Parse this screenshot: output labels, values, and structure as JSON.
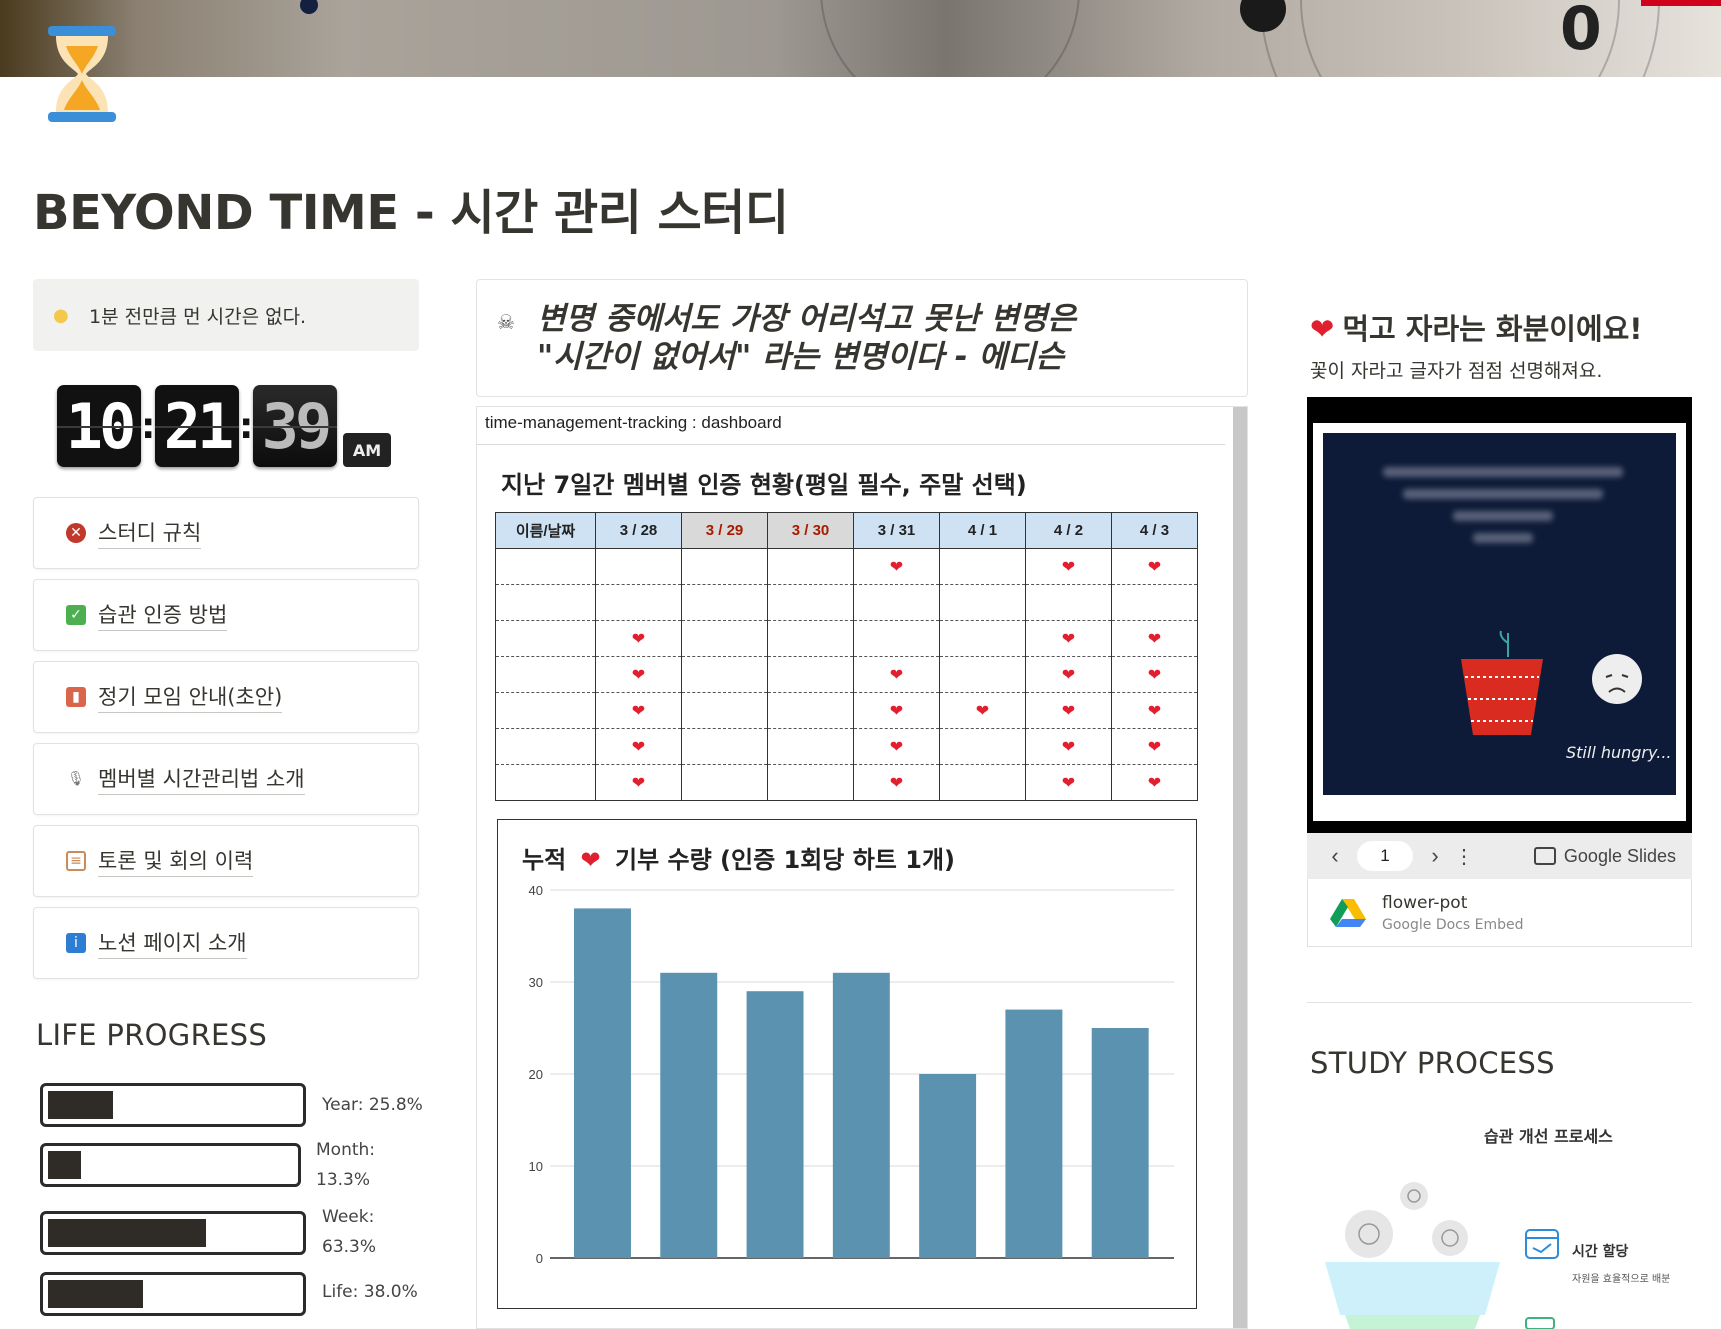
{
  "page": {
    "title": "BEYOND TIME - 시간 관리 스터디"
  },
  "callout": {
    "icon": "lightbulb-icon",
    "text": "1분 전만큼 먼 시간은 없다."
  },
  "clock": {
    "hours": "10",
    "minutes": "21",
    "seconds": "39",
    "ampm": "AM"
  },
  "nav": [
    {
      "label": "스터디 규칙",
      "icon": "no-pedestrians-icon",
      "color": "#c0392b"
    },
    {
      "label": "습관 인증 방법",
      "icon": "check-mark-icon",
      "color": "#4caf50"
    },
    {
      "label": "정기 모임 안내(초안)",
      "icon": "book-icon",
      "color": "#d9664b"
    },
    {
      "label": "멤버별 시간관리법 소개",
      "icon": "microphone-icon",
      "color": "#777777"
    },
    {
      "label": "토론 및 회의 이력",
      "icon": "clipboard-icon",
      "color": "#c98b5a"
    },
    {
      "label": "노션 페이지 소개",
      "icon": "info-icon",
      "color": "#2d7dd2"
    }
  ],
  "life_progress": {
    "heading": "LIFE PROGRESS",
    "items": [
      {
        "label": "Year: 25.8%",
        "fraction": 0.258
      },
      {
        "label_line1": "Month:",
        "label_line2": "13.3%",
        "fraction": 0.133
      },
      {
        "label_line1": "Week:",
        "label_line2": "63.3%",
        "fraction": 0.633
      },
      {
        "label": "Life: 38.0%",
        "fraction": 0.38
      }
    ]
  },
  "quote": {
    "icon": "skull-icon",
    "line1": "변명 중에서도 가장 어리석고 못난 변명은",
    "line2": "\"시간이 없어서\" 라는 변명이다 - 에디슨"
  },
  "embed": {
    "header": "time-management-tracking : dashboard",
    "table_title": "지난 7일간 멤버별 인증 현황(평일 필수, 주말 선택)",
    "columns": [
      "이름/날짜",
      "3 / 28",
      "3 / 29",
      "3 / 30",
      "3 / 31",
      "4 / 1",
      "4 / 2",
      "4 / 3"
    ],
    "weekend_cols": [
      2,
      3
    ],
    "rows": [
      [
        0,
        0,
        0,
        1,
        0,
        1,
        1
      ],
      [
        0,
        0,
        0,
        0,
        0,
        0,
        0
      ],
      [
        1,
        0,
        0,
        0,
        0,
        1,
        1
      ],
      [
        1,
        0,
        0,
        1,
        0,
        1,
        1
      ],
      [
        1,
        0,
        0,
        1,
        1,
        1,
        1
      ],
      [
        1,
        0,
        0,
        1,
        0,
        1,
        1
      ],
      [
        1,
        0,
        0,
        1,
        0,
        1,
        1
      ]
    ],
    "heart": "❤"
  },
  "chart_data": {
    "type": "bar",
    "title_prefix": "누적",
    "title_suffix": "기부 수량 (인증 1회당 하트 1개)",
    "categories": [
      "",
      "",
      "",
      "",
      "",
      "",
      ""
    ],
    "values": [
      38,
      31,
      29,
      31,
      20,
      27,
      25
    ],
    "ylim": [
      0,
      40
    ],
    "yticks": [
      0,
      10,
      20,
      30,
      40
    ],
    "bar_color": "#5a92b0",
    "grid": true
  },
  "right": {
    "heading": "먹고 자라는 화분이에요!",
    "heading_icon": "heart-icon",
    "sub": "꽃이 자라고  글자가 점점 선명해져요.",
    "slide_caption": "Still hungry...",
    "slides_page": "1",
    "slides_brand": "Google Slides",
    "bookmark_title": "flower-pot",
    "bookmark_sub": "Google Docs Embed"
  },
  "study_process": {
    "heading": "STUDY PROCESS",
    "diagram_title": "습관 개선 프로세스",
    "item_title": "시간 할당",
    "item_sub": "자원을 효율적으로 배분"
  }
}
